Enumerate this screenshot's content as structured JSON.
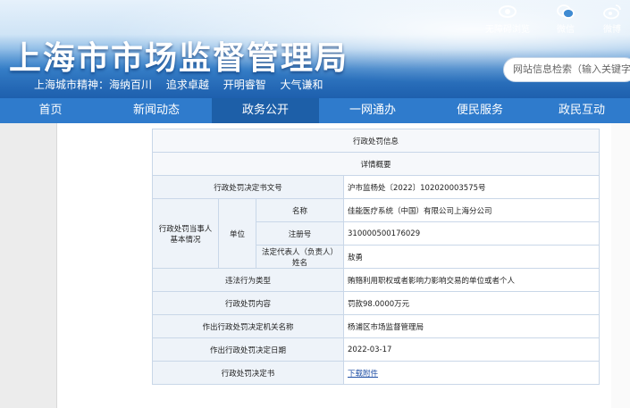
{
  "header": {
    "title": "上海市市场监督管理局",
    "slogan": [
      "上海城市精神：海纳百川",
      "追求卓越",
      "开明睿智",
      "大气谦和"
    ],
    "icons": [
      {
        "label": "无障碍浏览",
        "icon": "eye-icon"
      },
      {
        "label": "微信",
        "icon": "wechat-icon"
      },
      {
        "label": "微博",
        "icon": "weibo-icon"
      }
    ],
    "search_placeholder": "网站信息检索（输入关键字"
  },
  "nav": {
    "items": [
      "首页",
      "新闻动态",
      "政务公开",
      "一网通办",
      "便民服务",
      "政民互动"
    ],
    "active_index": 2
  },
  "table": {
    "title": "行政处罚信息",
    "subtitle": "详情概要",
    "doc_number_label": "行政处罚决定书文号",
    "doc_number": "沪市监杨处〔2022〕102020003575号",
    "party_label": "行政处罚当事人基本情况",
    "party_type": "单位",
    "name_label": "名称",
    "name": "佳能医疗系统（中国）有限公司上海分公司",
    "reg_label": "注册号",
    "reg": "310000500176029",
    "rep_label": "法定代表人（负责人）姓名",
    "rep": "敖勇",
    "violation_label": "违法行为类型",
    "violation": "贿赂利用职权或者影响力影响交易的单位或者个人",
    "content_label": "行政处罚内容",
    "content": "罚款98.0000万元",
    "authority_label": "作出行政处罚决定机关名称",
    "authority": "杨浦区市场监督管理局",
    "date_label": "作出行政处罚决定日期",
    "date": "2022-03-17",
    "decision_label": "行政处罚决定书",
    "decision_link": "下载附件"
  }
}
